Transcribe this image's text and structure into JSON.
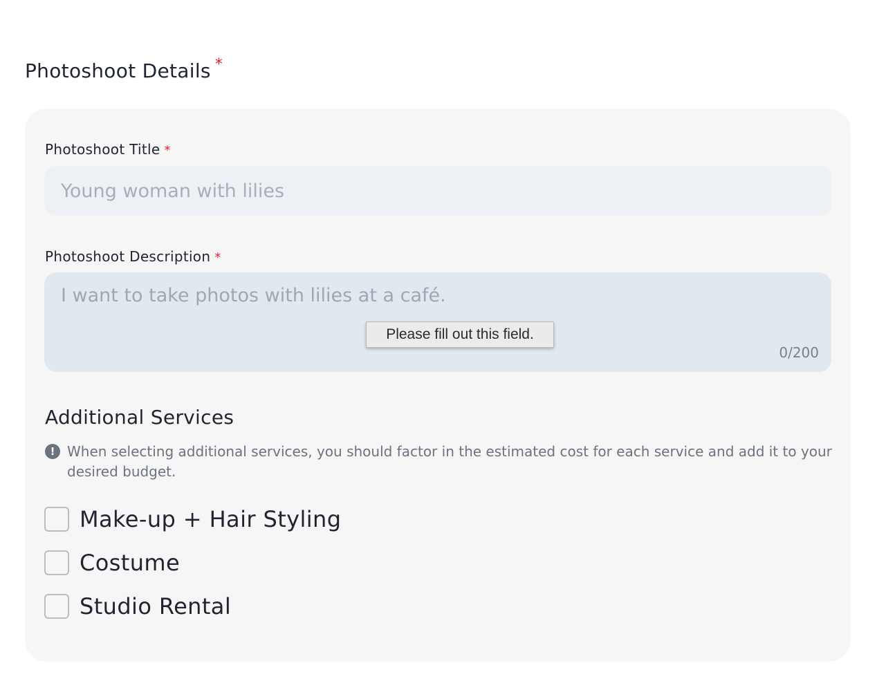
{
  "section": {
    "title": "Photoshoot Details",
    "required_mark": "*"
  },
  "fields": {
    "title": {
      "label": "Photoshoot Title",
      "required_mark": "*",
      "placeholder": "Young woman with lilies",
      "value": ""
    },
    "description": {
      "label": "Photoshoot Description",
      "required_mark": "*",
      "placeholder": "I want to take photos with lilies at a café.",
      "value": "",
      "counter": "0/200"
    }
  },
  "validation_tooltip": "Please fill out this field.",
  "services": {
    "title": "Additional Services",
    "info_icon": "exclamation-circle-icon",
    "info_icon_glyph": "!",
    "info_text": "When selecting additional services, you should factor in the estimated cost for each service and add it to your desired budget.",
    "options": [
      {
        "label": "Make-up + Hair Styling",
        "checked": false
      },
      {
        "label": "Costume",
        "checked": false
      },
      {
        "label": "Studio Rental",
        "checked": false
      }
    ]
  },
  "colors": {
    "required": "#e0242f",
    "card_bg": "#f6f6f6",
    "input_bg": "#edf1f5",
    "textarea_bg": "#e2e8f0",
    "text": "#1f2430",
    "muted": "#6b7280"
  }
}
